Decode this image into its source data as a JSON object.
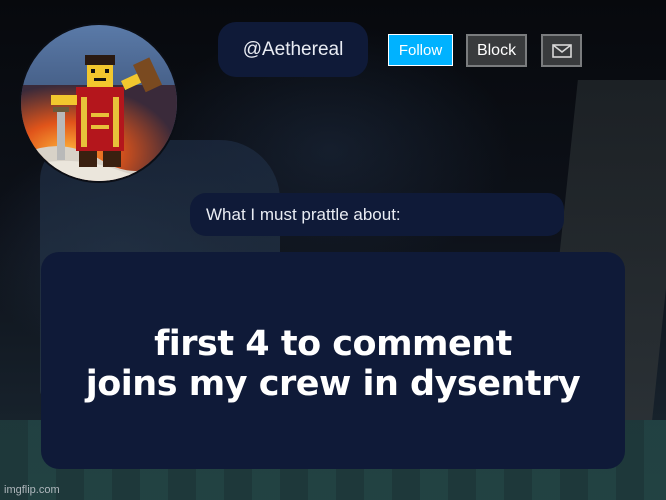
{
  "profile": {
    "handle": "@Aethereal",
    "avatar_alt": "avatar"
  },
  "actions": {
    "follow_label": "Follow",
    "block_label": "Block",
    "message_icon": "mail-icon"
  },
  "about": {
    "label": "What I must prattle about:"
  },
  "post": {
    "line1": "first 4 to comment",
    "line2": "joins my crew in dysentry"
  },
  "footer": {
    "watermark": "imgflip.com"
  },
  "colors": {
    "panel": "#0f1a38",
    "follow": "#00b2ff",
    "block": "#393b3d",
    "text": "#ffffff"
  }
}
